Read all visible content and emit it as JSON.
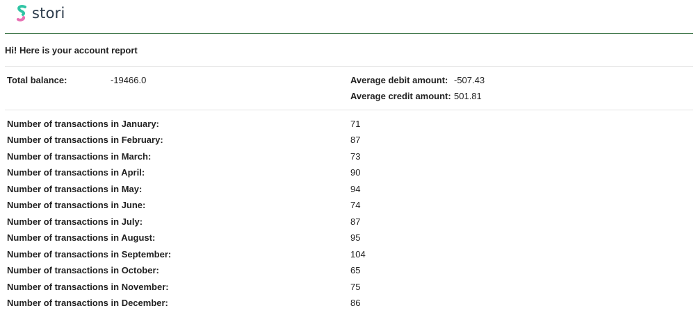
{
  "brand": {
    "name": "stori"
  },
  "greeting": "Hi! Here is your account report",
  "summary": {
    "total_balance_label": "Total balance:",
    "total_balance_value": "-19466.0",
    "avg_debit_label": "Average debit amount:",
    "avg_debit_value": "-507.43",
    "avg_credit_label": "Average credit amount:",
    "avg_credit_value": "501.81"
  },
  "transactions": [
    {
      "label": "Number of transactions in January:",
      "value": "71"
    },
    {
      "label": "Number of transactions in February:",
      "value": "87"
    },
    {
      "label": "Number of transactions in March:",
      "value": "73"
    },
    {
      "label": "Number of transactions in April:",
      "value": "90"
    },
    {
      "label": "Number of transactions in May:",
      "value": "94"
    },
    {
      "label": "Number of transactions in June:",
      "value": "74"
    },
    {
      "label": "Number of transactions in July:",
      "value": "87"
    },
    {
      "label": "Number of transactions in August:",
      "value": "95"
    },
    {
      "label": "Number of transactions in September:",
      "value": "104"
    },
    {
      "label": "Number of transactions in October:",
      "value": "65"
    },
    {
      "label": "Number of transactions in November:",
      "value": "75"
    },
    {
      "label": "Number of transactions in December:",
      "value": "86"
    }
  ],
  "colors": {
    "header_rule": "#2f6b3a",
    "logo_teal": "#2fc4a4",
    "logo_pink": "#e86fb3",
    "logo_text": "#2b3a4a"
  }
}
